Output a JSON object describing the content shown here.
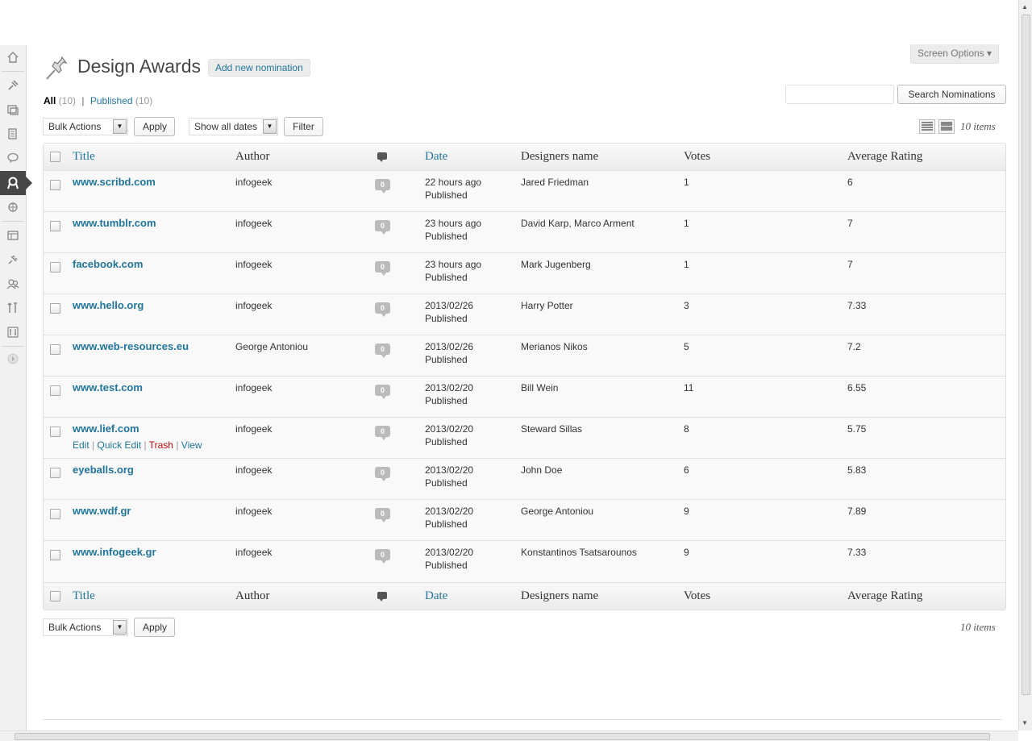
{
  "page": {
    "title": "Design Awards",
    "add_new": "Add new nomination",
    "screen_options": "Screen Options ▾"
  },
  "views": {
    "all": "All",
    "all_count": "(10)",
    "published": "Published",
    "published_count": "(10)"
  },
  "search": {
    "placeholder": "",
    "button": "Search Nominations"
  },
  "toolbar": {
    "bulk_actions": "Bulk Actions",
    "apply": "Apply",
    "dates": "Show all dates",
    "filter": "Filter",
    "items": "10 items"
  },
  "columns": {
    "title": "Title",
    "author": "Author",
    "date": "Date",
    "designers": "Designers name",
    "votes": "Votes",
    "rating": "Average Rating"
  },
  "row_actions": {
    "edit": "Edit",
    "quick_edit": "Quick Edit",
    "trash": "Trash",
    "view": "View"
  },
  "rows": [
    {
      "title": "www.scribd.com",
      "author": "infogeek",
      "comments": "0",
      "date": "22 hours ago",
      "status": "Published",
      "designers": "Jared Friedman",
      "votes": "1",
      "rating": "6"
    },
    {
      "title": "www.tumblr.com",
      "author": "infogeek",
      "comments": "0",
      "date": "23 hours ago",
      "status": "Published",
      "designers": "David Karp, Marco Arment",
      "votes": "1",
      "rating": "7"
    },
    {
      "title": "facebook.com",
      "author": "infogeek",
      "comments": "0",
      "date": "23 hours ago",
      "status": "Published",
      "designers": "Mark Jugenberg",
      "votes": "1",
      "rating": "7"
    },
    {
      "title": "www.hello.org",
      "author": "infogeek",
      "comments": "0",
      "date": "2013/02/26",
      "status": "Published",
      "designers": "Harry Potter",
      "votes": "3",
      "rating": "7.33"
    },
    {
      "title": "www.web-resources.eu",
      "author": "George Antoniou",
      "comments": "0",
      "date": "2013/02/26",
      "status": "Published",
      "designers": "Merianos Nikos",
      "votes": "5",
      "rating": "7.2"
    },
    {
      "title": "www.test.com",
      "author": "infogeek",
      "comments": "0",
      "date": "2013/02/20",
      "status": "Published",
      "designers": "Bill Wein",
      "votes": "11",
      "rating": "6.55"
    },
    {
      "title": "www.lief.com",
      "author": "infogeek",
      "comments": "0",
      "date": "2013/02/20",
      "status": "Published",
      "designers": "Steward Sillas",
      "votes": "8",
      "rating": "5.75"
    },
    {
      "title": "eyeballs.org",
      "author": "infogeek",
      "comments": "0",
      "date": "2013/02/20",
      "status": "Published",
      "designers": "John Doe",
      "votes": "6",
      "rating": "5.83"
    },
    {
      "title": "www.wdf.gr",
      "author": "infogeek",
      "comments": "0",
      "date": "2013/02/20",
      "status": "Published",
      "designers": "George Antoniou",
      "votes": "9",
      "rating": "7.89"
    },
    {
      "title": "www.infogeek.gr",
      "author": "infogeek",
      "comments": "0",
      "date": "2013/02/20",
      "status": "Published",
      "designers": "Konstantinos Tsatsarounos",
      "votes": "9",
      "rating": "7.33"
    }
  ],
  "menu_icons": [
    "dashboard-icon",
    "posts-icon",
    "media-icon",
    "pages-icon",
    "comments-icon",
    "nominations-icon",
    "links-icon",
    "appearance-icon",
    "plugins-icon",
    "users-icon",
    "tools-icon",
    "settings-icon",
    "collapse-icon"
  ],
  "colors": {
    "link": "#21759b",
    "menu_current": "#464646",
    "trash": "#bc0b0b"
  }
}
